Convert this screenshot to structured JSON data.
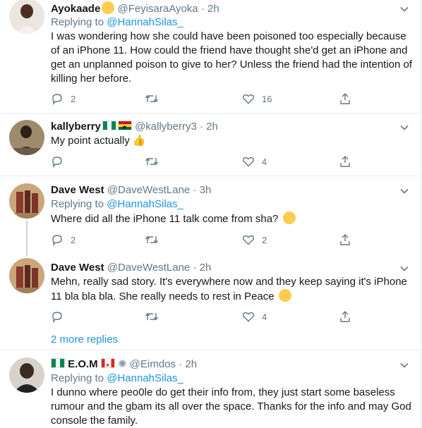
{
  "tweets": [
    {
      "name": "Ayokaade",
      "handle": "@FeyisaraAyoka",
      "dot": "·",
      "time": "2h",
      "replying_label": "Replying to",
      "replying_to": "@HannahSilas_",
      "text": "I was wondering how she could have been poisoned too especially because of an iPhone 11. How could the friend have thought she'd get an iPhone and get an unplanned poison to give to her? Unless the friend had the intention of killing her before.",
      "replies": "2",
      "retweets": "",
      "likes": "16"
    },
    {
      "name": "kallyberry",
      "handle": "@kallyberry3",
      "dot": "·",
      "time": "2h",
      "text": "My point actually",
      "replies": "",
      "retweets": "",
      "likes": "4"
    },
    {
      "name": "Dave West",
      "handle": "@DaveWestLane",
      "dot": "·",
      "time": "3h",
      "replying_label": "Replying to",
      "replying_to": "@HannahSilas_",
      "text": "Where did all the iPhone 11 talk come from sha?",
      "replies": "2",
      "retweets": "",
      "likes": "2"
    },
    {
      "name": "Dave West",
      "handle": "@DaveWestLane",
      "dot": "·",
      "time": "2h",
      "text": "Mehn, really sad story. It's everywhere now and they keep saying it's iPhone 11 bla bla bla. She really needs to rest in Peace",
      "replies": "",
      "retweets": "",
      "likes": "4"
    },
    {
      "name": "E.O.M",
      "handle": "@Eimdos",
      "dot": "·",
      "time": "2h",
      "replying_label": "Replying to",
      "replying_to": "@HannahSilas_",
      "text": "I dunno where peo0le do get their info from, they just start some baseless rumour and the gbam its all over the space. Thanks for the info and may God console the family."
    }
  ],
  "more_replies": "2 more replies",
  "colors": {
    "accent": "#1b95e0",
    "muted": "#657786",
    "divider": "#e6ecf0"
  }
}
